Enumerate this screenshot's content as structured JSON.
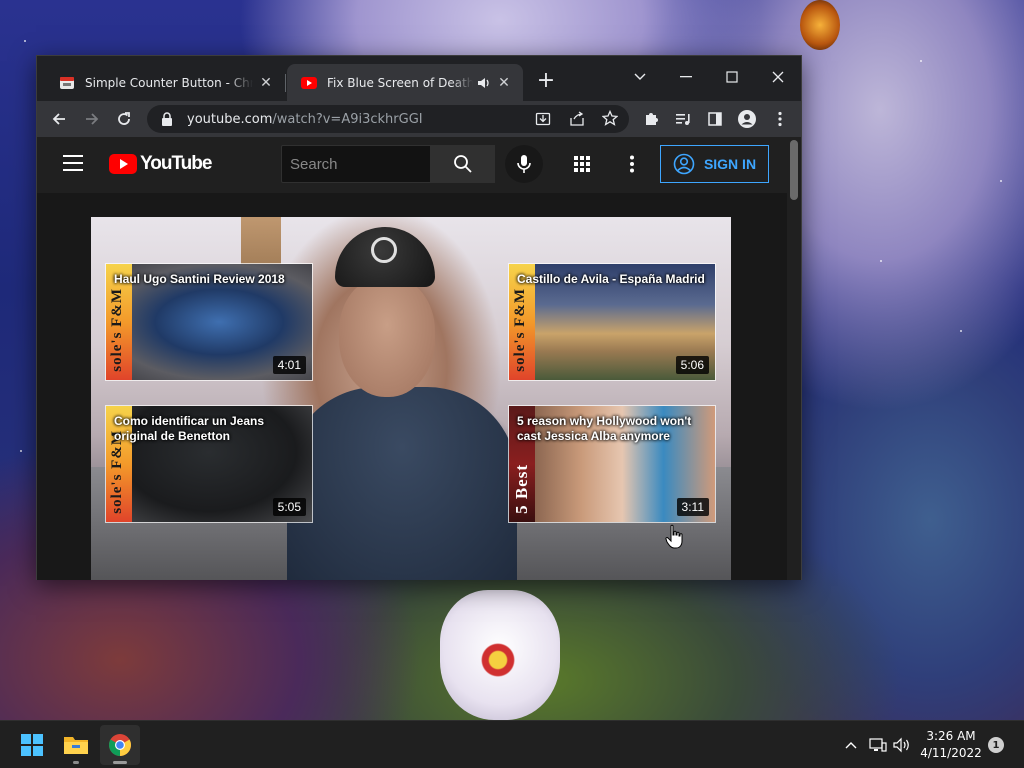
{
  "browser": {
    "tabs": [
      {
        "title": "Simple Counter Button - Chrome",
        "active": false
      },
      {
        "title": "Fix Blue Screen of Death in Windows",
        "active": true,
        "audio": true
      }
    ],
    "address": {
      "host": "youtube.com",
      "path": "/watch?v=A9i3ckhrGGI"
    }
  },
  "youtube": {
    "logo_text": "YouTube",
    "search_placeholder": "Search",
    "sign_in_label": "SIGN IN"
  },
  "endcards": [
    {
      "title": "Haul Ugo Santini Review 2018",
      "duration": "4:01",
      "channel_mark": "sole's F&M"
    },
    {
      "title": "Castillo de Avila - España Madrid",
      "duration": "5:06",
      "channel_mark": "sole's F&M"
    },
    {
      "title": "Como identificar un Jeans original de Benetton",
      "duration": "5:05",
      "channel_mark": "sole's F&M"
    },
    {
      "title": "5 reason why Hollywood won't cast Jessica Alba anymore",
      "duration": "3:11",
      "channel_mark": "5 Best"
    }
  ],
  "taskbar": {
    "time": "3:26 AM",
    "date": "4/11/2022",
    "notification_count": "1"
  },
  "colors": {
    "yt_red": "#ff0000",
    "signin_blue": "#3ea6ff",
    "chrome_dark": "#202124"
  }
}
